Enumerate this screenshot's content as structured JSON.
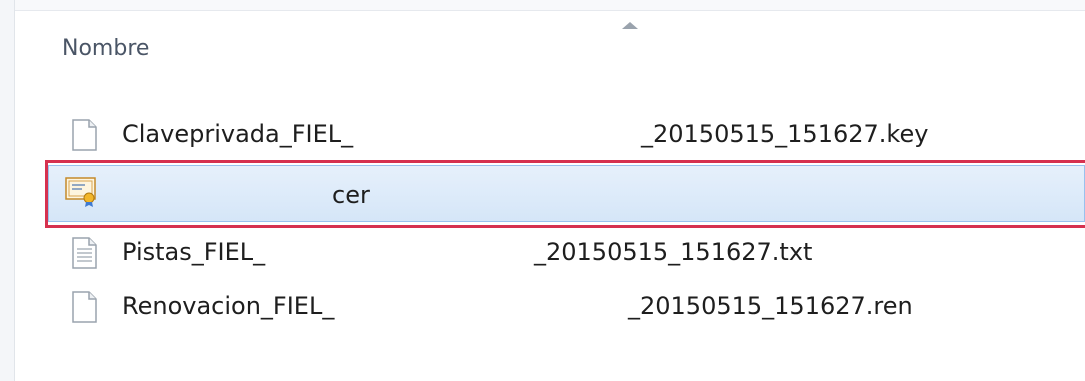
{
  "header": {
    "column_name": "Nombre"
  },
  "files": [
    {
      "name": "Claveprivada_FIEL_",
      "suffix": "_20150515_151627.key",
      "icon": "blank-document-icon"
    },
    {
      "name": "",
      "suffix": "cer",
      "icon": "certificate-icon",
      "selected": true
    },
    {
      "name": "Pistas_FIEL_",
      "suffix": "_20150515_151627.txt",
      "icon": "text-document-icon"
    },
    {
      "name": "Renovacion_FIEL_",
      "suffix": "_20150515_151627.ren",
      "icon": "blank-document-icon"
    }
  ],
  "colors": {
    "highlight_border": "#d6314f",
    "selection_bg": "#d5e6f8",
    "selection_border": "#99c1ee"
  }
}
